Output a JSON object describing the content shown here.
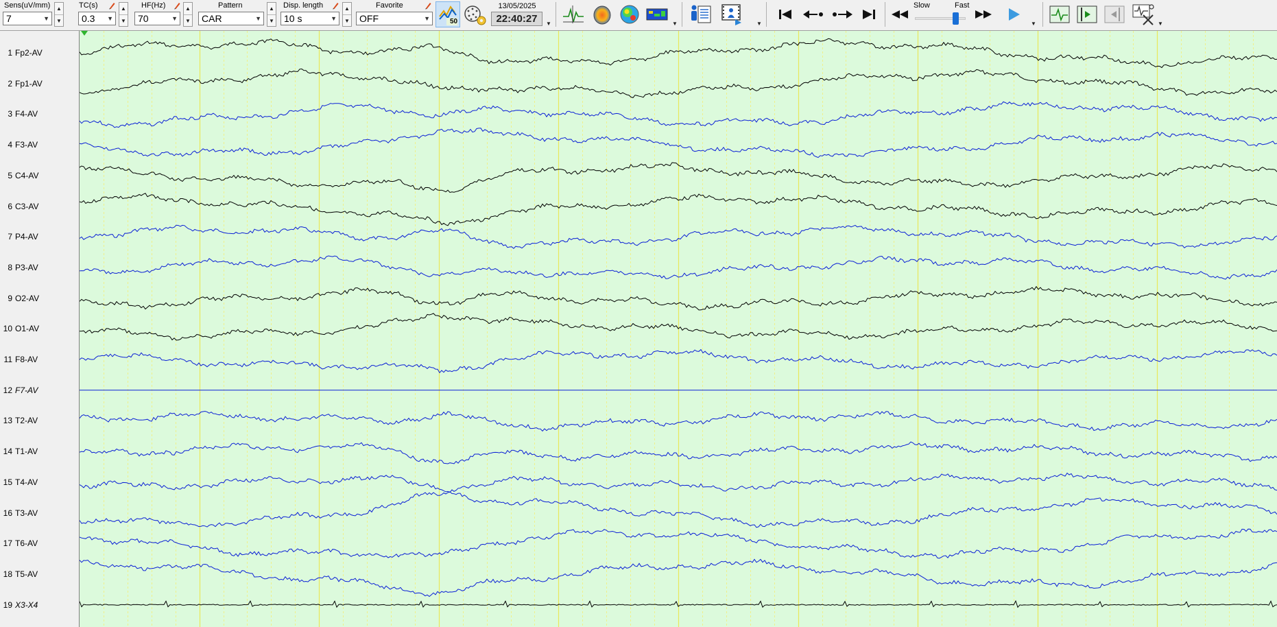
{
  "toolbar": {
    "sens": {
      "label": "Sens(uV/mm)",
      "value": "7"
    },
    "tc": {
      "label": "TC(s)",
      "value": "0.3"
    },
    "hf": {
      "label": "HF(Hz)",
      "value": "70"
    },
    "pattern": {
      "label": "Pattern",
      "value": "CAR"
    },
    "disp_length": {
      "label": "Disp. length",
      "value": "10 s"
    },
    "favorite": {
      "label": "Favorite",
      "value": "OFF"
    },
    "badge_number": "50",
    "date": "13/05/2025",
    "time": "22:40:27",
    "speed": {
      "slow_label": "Slow",
      "fast_label": "Fast",
      "level": 0.85
    }
  },
  "channels": [
    {
      "num": "1",
      "name": "Fp2-AV",
      "color": "#000000",
      "italic": false
    },
    {
      "num": "2",
      "name": "Fp1-AV",
      "color": "#000000",
      "italic": false
    },
    {
      "num": "3",
      "name": "F4-AV",
      "color": "#0a1fd6",
      "italic": false
    },
    {
      "num": "4",
      "name": "F3-AV",
      "color": "#0a1fd6",
      "italic": false
    },
    {
      "num": "5",
      "name": "C4-AV",
      "color": "#000000",
      "italic": false
    },
    {
      "num": "6",
      "name": "C3-AV",
      "color": "#000000",
      "italic": false
    },
    {
      "num": "7",
      "name": "P4-AV",
      "color": "#0a1fd6",
      "italic": false
    },
    {
      "num": "8",
      "name": "P3-AV",
      "color": "#0a1fd6",
      "italic": false
    },
    {
      "num": "9",
      "name": "O2-AV",
      "color": "#000000",
      "italic": false
    },
    {
      "num": "10",
      "name": "O1-AV",
      "color": "#000000",
      "italic": false
    },
    {
      "num": "11",
      "name": "F8-AV",
      "color": "#0a1fd6",
      "italic": false
    },
    {
      "num": "12",
      "name": "F7-AV",
      "color": "#0a1fd6",
      "italic": true
    },
    {
      "num": "13",
      "name": "T2-AV",
      "color": "#0a1fd6",
      "italic": false
    },
    {
      "num": "14",
      "name": "T1-AV",
      "color": "#0a1fd6",
      "italic": false
    },
    {
      "num": "15",
      "name": "T4-AV",
      "color": "#0a1fd6",
      "italic": false
    },
    {
      "num": "16",
      "name": "T3-AV",
      "color": "#0a1fd6",
      "italic": false
    },
    {
      "num": "17",
      "name": "T6-AV",
      "color": "#0a1fd6",
      "italic": false
    },
    {
      "num": "18",
      "name": "T5-AV",
      "color": "#0a1fd6",
      "italic": false
    },
    {
      "num": "19",
      "name": "X3-X4",
      "color": "#000000",
      "italic": true
    }
  ],
  "colors": {
    "waveform_bg": "#dcfadc",
    "second_line": "#e8e85a",
    "subsecond_line": "#f0f08a",
    "flat_channel": "#0a1fd6"
  }
}
